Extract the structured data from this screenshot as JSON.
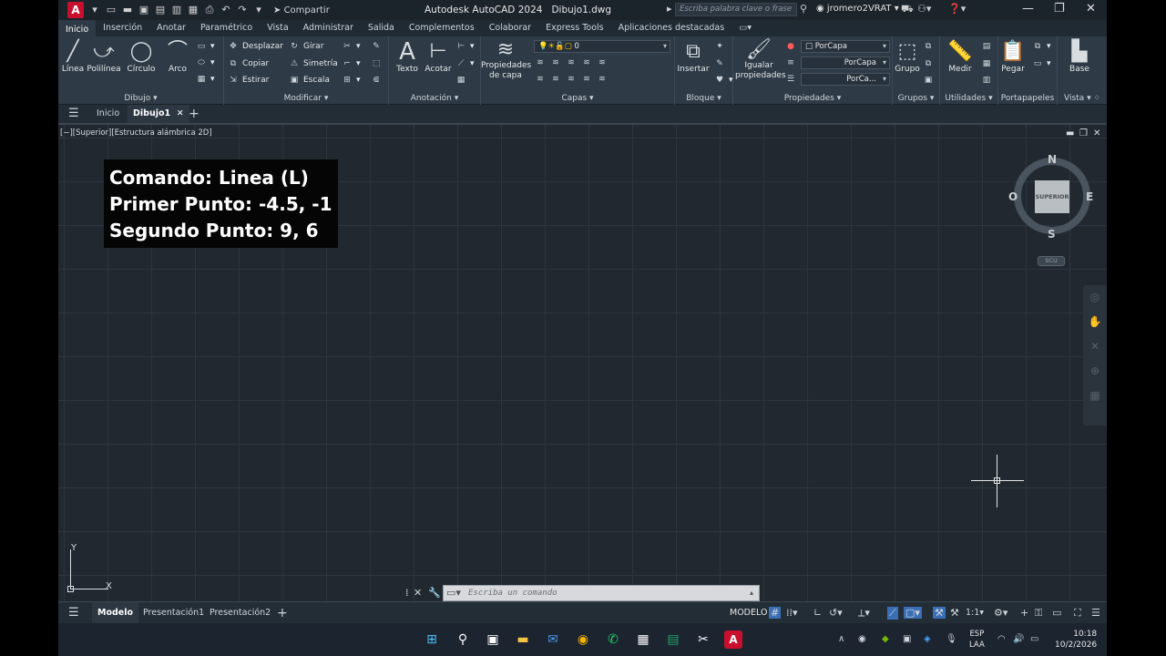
{
  "app": {
    "logo": "A",
    "title": "Autodesk AutoCAD 2024",
    "file": "Dibujo1.dwg",
    "share_label": "Compartir",
    "search_placeholder": "Escriba palabra clave o frase",
    "user": "jromero2VRAT"
  },
  "ribbon_tabs": [
    "Inicio",
    "Inserción",
    "Anotar",
    "Paramétrico",
    "Vista",
    "Administrar",
    "Salida",
    "Complementos",
    "Colaborar",
    "Express Tools",
    "Aplicaciones destacadas"
  ],
  "ribbon": {
    "dibujo": {
      "label": "Dibujo",
      "tools": [
        "Línea",
        "Polilínea",
        "Círculo",
        "Arco"
      ]
    },
    "modificar": {
      "label": "Modificar",
      "tools": [
        "Desplazar",
        "Girar",
        "Copiar",
        "Simetría",
        "Estirar",
        "Escala"
      ]
    },
    "anotacion": {
      "label": "Anotación",
      "tools": [
        "Texto",
        "Acotar"
      ]
    },
    "capas": {
      "label": "Capas",
      "props": "Propiedades de capa",
      "layer": "0"
    },
    "bloque": {
      "label": "Bloque",
      "insert": "Insertar"
    },
    "propiedades": {
      "label": "Propiedades",
      "match": "Igualar propiedades",
      "color": "PorCapa",
      "linetype": "PorCapa",
      "lineweight": "PorCa..."
    },
    "grupos": {
      "label": "Grupos",
      "tool": "Grupo"
    },
    "utilidades": {
      "label": "Utilidades",
      "tool": "Medir"
    },
    "portapapeles": {
      "label": "Portapapeles",
      "tool": "Pegar"
    },
    "vista": {
      "label": "Vista",
      "tool": "Base"
    }
  },
  "file_tabs": {
    "home": "Inicio",
    "active": "Dibujo1"
  },
  "viewport": {
    "label": "[−][Superior][Estructura alámbrica 2D]",
    "overlay": [
      "Comando: Linea (L)",
      "Primer Punto: -4.5, -1",
      "Segundo Punto: 9, 6"
    ],
    "viewcube": {
      "face": "SUPERIOR",
      "n": "N",
      "s": "S",
      "e": "E",
      "w": "O"
    },
    "ucs_label": "SCU",
    "axis_x": "X",
    "axis_y": "Y"
  },
  "command": {
    "placeholder": "Escriba un comando"
  },
  "status": {
    "tabs": [
      "Modelo",
      "Presentación1",
      "Presentación2"
    ],
    "mode": "MODELO",
    "scale": "1:1"
  },
  "taskbar": {
    "lang1": "ESP",
    "lang2": "LAA",
    "time": "10:18",
    "date": "10/2/2026"
  }
}
